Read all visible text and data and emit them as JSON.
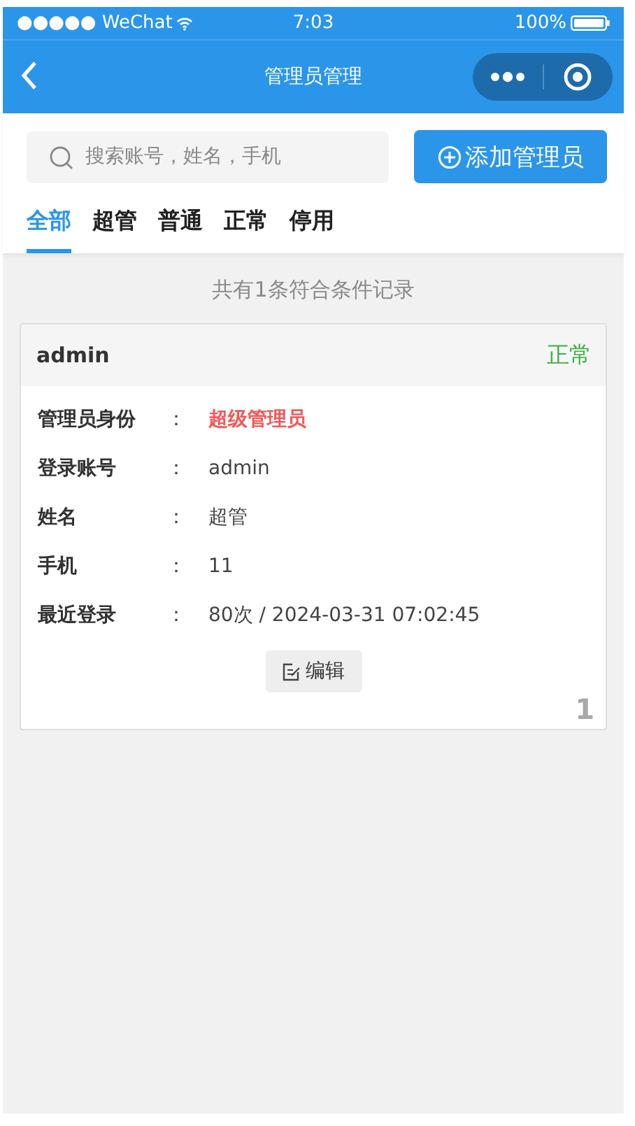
{
  "status_bar": {
    "carrier": "●●●●● WeChat",
    "time": "7:03",
    "battery": "100%"
  },
  "nav": {
    "title": "管理员管理"
  },
  "search": {
    "placeholder": "搜索账号，姓名，手机"
  },
  "add_button": {
    "label": "添加管理员"
  },
  "tabs": [
    {
      "label": "全部",
      "selected": true
    },
    {
      "label": "超管",
      "selected": false
    },
    {
      "label": "普通",
      "selected": false
    },
    {
      "label": "正常",
      "selected": false
    },
    {
      "label": "停用",
      "selected": false
    }
  ],
  "summary": "共有1条符合条件记录",
  "cards": [
    {
      "name": "admin",
      "status": "正常",
      "index": "1",
      "edit_label": "编辑",
      "fields": [
        {
          "label": "管理员身份",
          "separator": "：",
          "value": "超级管理员",
          "kind": "role"
        },
        {
          "label": "登录账号",
          "separator": "：",
          "value": "admin",
          "kind": "plain"
        },
        {
          "label": "姓名",
          "separator": "：",
          "value": "超管",
          "kind": "plain"
        },
        {
          "label": "手机",
          "separator": "：",
          "value": "11",
          "kind": "plain"
        },
        {
          "label": "最近登录",
          "separator": "：",
          "value": "80次 / 2024-03-31 07:02:45",
          "kind": "plain"
        }
      ]
    }
  ]
}
